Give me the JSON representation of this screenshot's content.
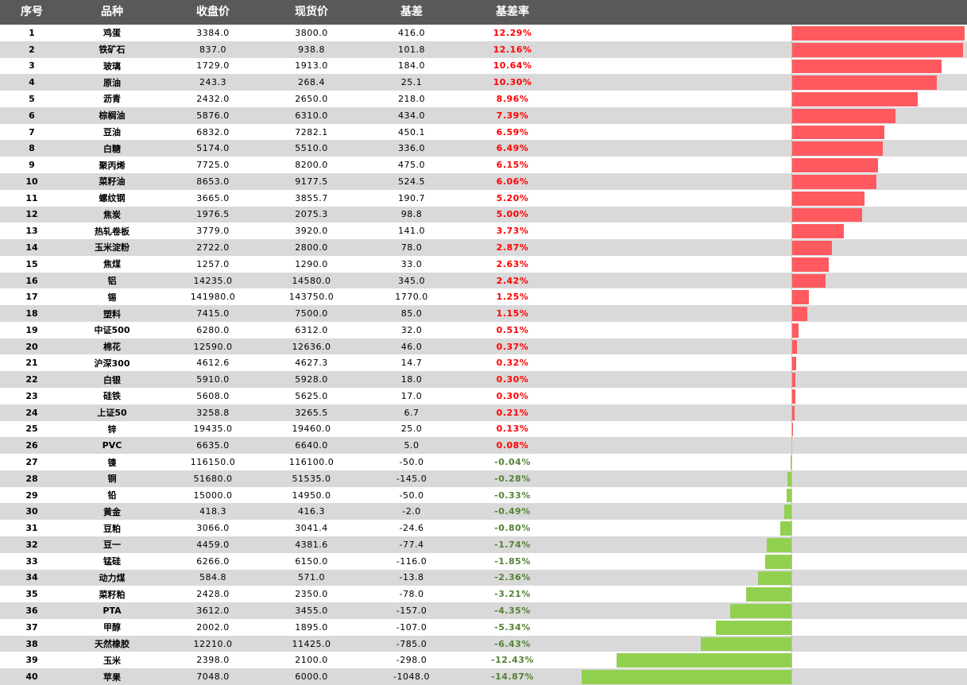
{
  "headers": [
    "序号",
    "品种",
    "收盘价",
    "现货价",
    "基差",
    "基差率"
  ],
  "colors": {
    "positive": "#ff5a5f",
    "negative": "#92d050",
    "rate_positive_text": "#ff0000",
    "rate_negative_text": "#548235",
    "header_bg": "#595959"
  },
  "chart_data": {
    "type": "bar",
    "orientation": "horizontal",
    "value_field": "基差率 (%)",
    "rows": [
      {
        "no": "1",
        "name": "鸡蛋",
        "close": "3384.0",
        "spot": "3800.0",
        "basis": "416.0",
        "rate_text": "12.29%",
        "rate": 12.29
      },
      {
        "no": "2",
        "name": "铁矿石",
        "close": "837.0",
        "spot": "938.8",
        "basis": "101.8",
        "rate_text": "12.16%",
        "rate": 12.16
      },
      {
        "no": "3",
        "name": "玻璃",
        "close": "1729.0",
        "spot": "1913.0",
        "basis": "184.0",
        "rate_text": "10.64%",
        "rate": 10.64
      },
      {
        "no": "4",
        "name": "原油",
        "close": "243.3",
        "spot": "268.4",
        "basis": "25.1",
        "rate_text": "10.30%",
        "rate": 10.3
      },
      {
        "no": "5",
        "name": "沥青",
        "close": "2432.0",
        "spot": "2650.0",
        "basis": "218.0",
        "rate_text": "8.96%",
        "rate": 8.96
      },
      {
        "no": "6",
        "name": "棕榈油",
        "close": "5876.0",
        "spot": "6310.0",
        "basis": "434.0",
        "rate_text": "7.39%",
        "rate": 7.39
      },
      {
        "no": "7",
        "name": "豆油",
        "close": "6832.0",
        "spot": "7282.1",
        "basis": "450.1",
        "rate_text": "6.59%",
        "rate": 6.59
      },
      {
        "no": "8",
        "name": "白糖",
        "close": "5174.0",
        "spot": "5510.0",
        "basis": "336.0",
        "rate_text": "6.49%",
        "rate": 6.49
      },
      {
        "no": "9",
        "name": "聚丙烯",
        "close": "7725.0",
        "spot": "8200.0",
        "basis": "475.0",
        "rate_text": "6.15%",
        "rate": 6.15
      },
      {
        "no": "10",
        "name": "菜籽油",
        "close": "8653.0",
        "spot": "9177.5",
        "basis": "524.5",
        "rate_text": "6.06%",
        "rate": 6.06
      },
      {
        "no": "11",
        "name": "螺纹钢",
        "close": "3665.0",
        "spot": "3855.7",
        "basis": "190.7",
        "rate_text": "5.20%",
        "rate": 5.2
      },
      {
        "no": "12",
        "name": "焦炭",
        "close": "1976.5",
        "spot": "2075.3",
        "basis": "98.8",
        "rate_text": "5.00%",
        "rate": 5.0
      },
      {
        "no": "13",
        "name": "热轧卷板",
        "close": "3779.0",
        "spot": "3920.0",
        "basis": "141.0",
        "rate_text": "3.73%",
        "rate": 3.73
      },
      {
        "no": "14",
        "name": "玉米淀粉",
        "close": "2722.0",
        "spot": "2800.0",
        "basis": "78.0",
        "rate_text": "2.87%",
        "rate": 2.87
      },
      {
        "no": "15",
        "name": "焦煤",
        "close": "1257.0",
        "spot": "1290.0",
        "basis": "33.0",
        "rate_text": "2.63%",
        "rate": 2.63
      },
      {
        "no": "16",
        "name": "铝",
        "close": "14235.0",
        "spot": "14580.0",
        "basis": "345.0",
        "rate_text": "2.42%",
        "rate": 2.42
      },
      {
        "no": "17",
        "name": "锡",
        "close": "141980.0",
        "spot": "143750.0",
        "basis": "1770.0",
        "rate_text": "1.25%",
        "rate": 1.25
      },
      {
        "no": "18",
        "name": "塑料",
        "close": "7415.0",
        "spot": "7500.0",
        "basis": "85.0",
        "rate_text": "1.15%",
        "rate": 1.15
      },
      {
        "no": "19",
        "name": "中证500",
        "close": "6280.0",
        "spot": "6312.0",
        "basis": "32.0",
        "rate_text": "0.51%",
        "rate": 0.51
      },
      {
        "no": "20",
        "name": "棉花",
        "close": "12590.0",
        "spot": "12636.0",
        "basis": "46.0",
        "rate_text": "0.37%",
        "rate": 0.37
      },
      {
        "no": "21",
        "name": "沪深300",
        "close": "4612.6",
        "spot": "4627.3",
        "basis": "14.7",
        "rate_text": "0.32%",
        "rate": 0.32
      },
      {
        "no": "22",
        "name": "白银",
        "close": "5910.0",
        "spot": "5928.0",
        "basis": "18.0",
        "rate_text": "0.30%",
        "rate": 0.3
      },
      {
        "no": "23",
        "name": "硅铁",
        "close": "5608.0",
        "spot": "5625.0",
        "basis": "17.0",
        "rate_text": "0.30%",
        "rate": 0.3
      },
      {
        "no": "24",
        "name": "上证50",
        "close": "3258.8",
        "spot": "3265.5",
        "basis": "6.7",
        "rate_text": "0.21%",
        "rate": 0.21
      },
      {
        "no": "25",
        "name": "锌",
        "close": "19435.0",
        "spot": "19460.0",
        "basis": "25.0",
        "rate_text": "0.13%",
        "rate": 0.13
      },
      {
        "no": "26",
        "name": "PVC",
        "close": "6635.0",
        "spot": "6640.0",
        "basis": "5.0",
        "rate_text": "0.08%",
        "rate": 0.08
      },
      {
        "no": "27",
        "name": "镍",
        "close": "116150.0",
        "spot": "116100.0",
        "basis": "-50.0",
        "rate_text": "-0.04%",
        "rate": -0.04
      },
      {
        "no": "28",
        "name": "铜",
        "close": "51680.0",
        "spot": "51535.0",
        "basis": "-145.0",
        "rate_text": "-0.28%",
        "rate": -0.28
      },
      {
        "no": "29",
        "name": "铅",
        "close": "15000.0",
        "spot": "14950.0",
        "basis": "-50.0",
        "rate_text": "-0.33%",
        "rate": -0.33
      },
      {
        "no": "30",
        "name": "黄金",
        "close": "418.3",
        "spot": "416.3",
        "basis": "-2.0",
        "rate_text": "-0.49%",
        "rate": -0.49
      },
      {
        "no": "31",
        "name": "豆粕",
        "close": "3066.0",
        "spot": "3041.4",
        "basis": "-24.6",
        "rate_text": "-0.80%",
        "rate": -0.8
      },
      {
        "no": "32",
        "name": "豆一",
        "close": "4459.0",
        "spot": "4381.6",
        "basis": "-77.4",
        "rate_text": "-1.74%",
        "rate": -1.74
      },
      {
        "no": "33",
        "name": "锰硅",
        "close": "6266.0",
        "spot": "6150.0",
        "basis": "-116.0",
        "rate_text": "-1.85%",
        "rate": -1.85
      },
      {
        "no": "34",
        "name": "动力煤",
        "close": "584.8",
        "spot": "571.0",
        "basis": "-13.8",
        "rate_text": "-2.36%",
        "rate": -2.36
      },
      {
        "no": "35",
        "name": "菜籽粕",
        "close": "2428.0",
        "spot": "2350.0",
        "basis": "-78.0",
        "rate_text": "-3.21%",
        "rate": -3.21
      },
      {
        "no": "36",
        "name": "PTA",
        "close": "3612.0",
        "spot": "3455.0",
        "basis": "-157.0",
        "rate_text": "-4.35%",
        "rate": -4.35
      },
      {
        "no": "37",
        "name": "甲醇",
        "close": "2002.0",
        "spot": "1895.0",
        "basis": "-107.0",
        "rate_text": "-5.34%",
        "rate": -5.34
      },
      {
        "no": "38",
        "name": "天然橡胶",
        "close": "12210.0",
        "spot": "11425.0",
        "basis": "-785.0",
        "rate_text": "-6.43%",
        "rate": -6.43
      },
      {
        "no": "39",
        "name": "玉米",
        "close": "2398.0",
        "spot": "2100.0",
        "basis": "-298.0",
        "rate_text": "-12.43%",
        "rate": -12.43
      },
      {
        "no": "40",
        "name": "苹果",
        "close": "7048.0",
        "spot": "6000.0",
        "basis": "-1048.0",
        "rate_text": "-14.87%",
        "rate": -14.87
      }
    ]
  }
}
